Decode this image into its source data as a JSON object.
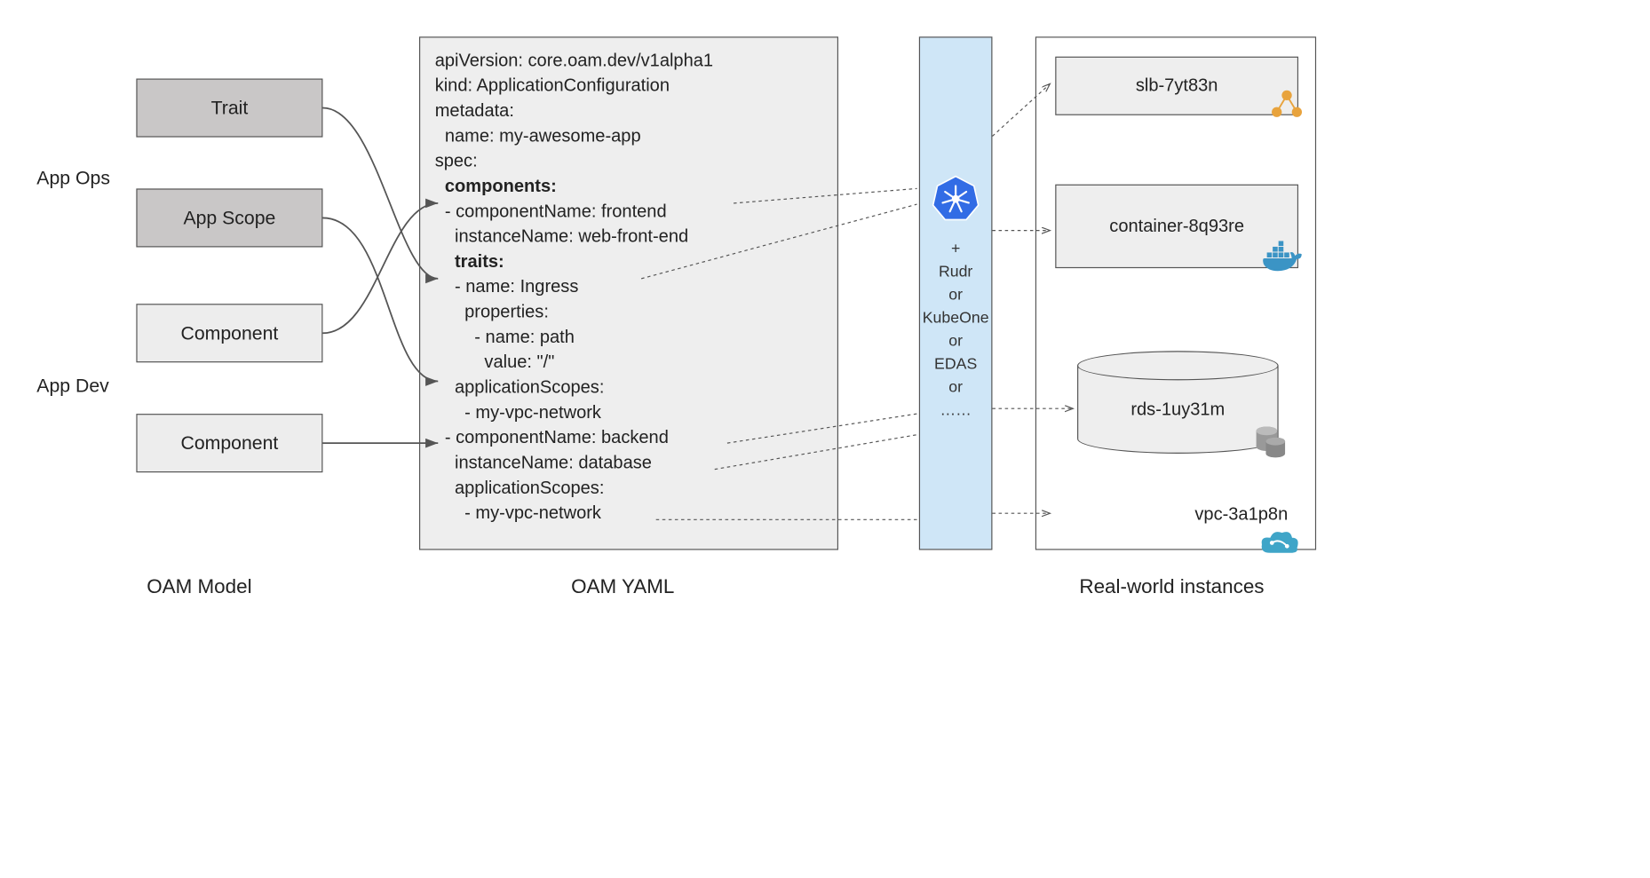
{
  "roles": {
    "appOps": "App Ops",
    "appDev": "App Dev"
  },
  "model": {
    "trait": "Trait",
    "appScope": "App Scope",
    "component1": "Component",
    "component2": "Component"
  },
  "yaml": {
    "lines": [
      {
        "text": "apiVersion: core.oam.dev/v1alpha1",
        "indent": 0,
        "bold": false
      },
      {
        "text": "kind: ApplicationConfiguration",
        "indent": 0,
        "bold": false
      },
      {
        "text": "metadata:",
        "indent": 0,
        "bold": false
      },
      {
        "text": "  name: my-awesome-app",
        "indent": 0,
        "bold": false
      },
      {
        "text": "spec:",
        "indent": 0,
        "bold": false
      },
      {
        "text": "  components:",
        "indent": 0,
        "bold": true
      },
      {
        "text": "  - componentName: frontend",
        "indent": 0,
        "bold": false
      },
      {
        "text": "    instanceName: web-front-end",
        "indent": 0,
        "bold": false
      },
      {
        "text": "    traits:",
        "indent": 0,
        "bold": true
      },
      {
        "text": "    - name: Ingress",
        "indent": 0,
        "bold": false
      },
      {
        "text": "      properties:",
        "indent": 0,
        "bold": false
      },
      {
        "text": "        - name: path",
        "indent": 0,
        "bold": false
      },
      {
        "text": "          value: \"/\"",
        "indent": 0,
        "bold": false
      },
      {
        "text": "    applicationScopes:",
        "indent": 0,
        "bold": false
      },
      {
        "text": "      - my-vpc-network",
        "indent": 0,
        "bold": false
      },
      {
        "text": "  - componentName: backend",
        "indent": 0,
        "bold": false
      },
      {
        "text": "    instanceName: database",
        "indent": 0,
        "bold": false
      },
      {
        "text": "    applicationScopes:",
        "indent": 0,
        "bold": false
      },
      {
        "text": "      - my-vpc-network",
        "indent": 0,
        "bold": false
      }
    ]
  },
  "runtime": {
    "plus": "+",
    "items": [
      "Rudr",
      "or",
      "KubeOne",
      "or",
      "EDAS",
      "or",
      "……"
    ]
  },
  "instances": {
    "slb": "slb-7yt83n",
    "container": "container-8q93re",
    "rds": "rds-1uy31m",
    "vpc": "vpc-3a1p8n"
  },
  "columns": {
    "model": "OAM Model",
    "yaml": "OAM YAML",
    "instances": "Real-world instances"
  }
}
